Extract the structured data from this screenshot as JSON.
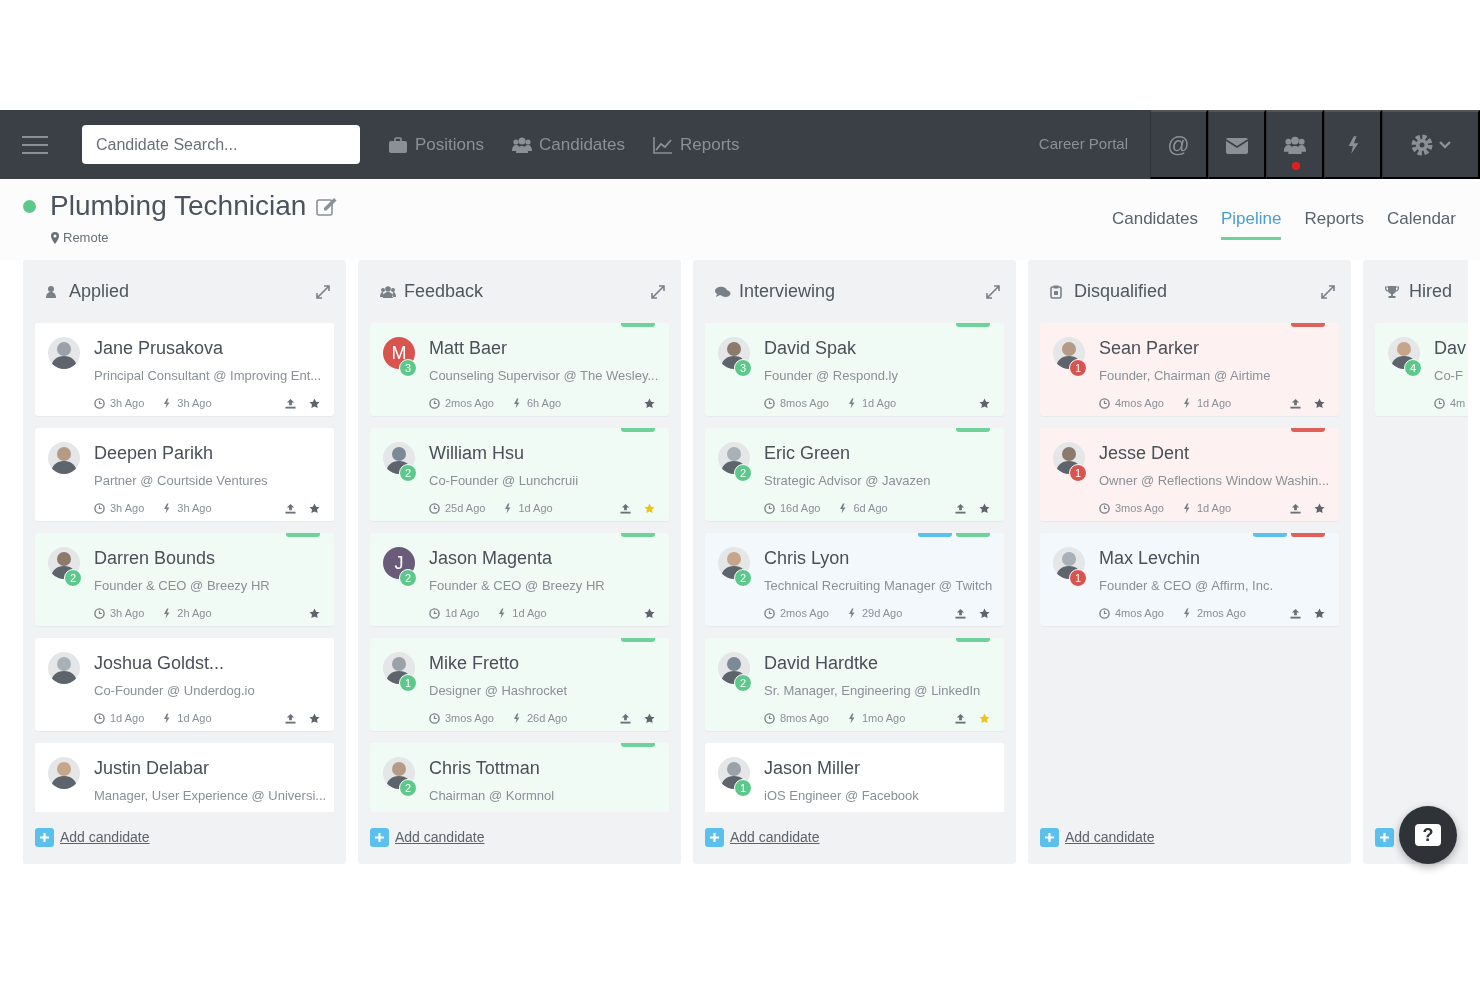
{
  "navbar": {
    "search": {
      "placeholder": "Candidate Search..."
    },
    "links": [
      {
        "label": "Positions"
      },
      {
        "label": "Candidates"
      },
      {
        "label": "Reports"
      }
    ],
    "career_portal": "Career Portal",
    "at_symbol": "@",
    "notification": true
  },
  "header": {
    "title": "Plumbing Technician",
    "location": "Remote",
    "tabs": [
      {
        "label": "Candidates",
        "selected": false
      },
      {
        "label": "Pipeline",
        "selected": true
      },
      {
        "label": "Reports",
        "selected": false
      },
      {
        "label": "Calendar",
        "selected": false
      }
    ]
  },
  "columns": [
    {
      "title": "Applied",
      "expandable": true,
      "add_label": "Add candidate",
      "cards": [
        {
          "name": "Jane Prusakova",
          "subtitle": "Principal Consultant @ Improving Ent...",
          "avatar": {
            "kind": "photo"
          },
          "ago": "3h Ago",
          "active": "3h Ago",
          "upload": true,
          "starred": false
        },
        {
          "name": "Deepen Parikh",
          "subtitle": "Partner @ Courtside Ventures",
          "avatar": {
            "kind": "photo"
          },
          "ago": "3h Ago",
          "active": "3h Ago",
          "upload": true,
          "starred": false
        },
        {
          "name": "Darren Bounds",
          "subtitle": "Founder & CEO @ Breezy HR",
          "avatar": {
            "kind": "photo"
          },
          "badge": {
            "text": "2",
            "color": "#5cc98a"
          },
          "tags": [
            {
              "color": "#6dd39a"
            }
          ],
          "color": "#f1fbf5",
          "ago": "3h Ago",
          "active": "2h Ago",
          "upload": false,
          "starred": false
        },
        {
          "name": "Joshua Goldst...",
          "subtitle": "Co-Founder @ Underdog.io",
          "avatar": {
            "kind": "photo"
          },
          "ago": "1d Ago",
          "active": "1d Ago",
          "upload": true,
          "starred": false
        },
        {
          "name": "Justin Delabar",
          "subtitle": "Manager, User Experience @ Universi...",
          "avatar": {
            "kind": "photo"
          }
        }
      ]
    },
    {
      "title": "Feedback",
      "expandable": true,
      "add_label": "Add candidate",
      "cards": [
        {
          "name": "Matt Baer",
          "subtitle": "Counseling Supervisor @ The Wesley...",
          "avatar": {
            "kind": "initial",
            "letter": "M",
            "color": "#d9534f"
          },
          "badge": {
            "text": "3",
            "color": "#5cc98a"
          },
          "tags": [
            {
              "color": "#6dd39a"
            }
          ],
          "color": "#f1fbf5",
          "ago": "2mos Ago",
          "active": "6h Ago",
          "upload": false,
          "starred": false
        },
        {
          "name": "William Hsu",
          "subtitle": "Co-Founder @ Lunchcruii",
          "avatar": {
            "kind": "photo"
          },
          "badge": {
            "text": "2",
            "color": "#5cc98a"
          },
          "tags": [
            {
              "color": "#6dd39a"
            }
          ],
          "color": "#f1fbf5",
          "ago": "25d Ago",
          "active": "1d Ago",
          "upload": true,
          "starred": true
        },
        {
          "name": "Jason Magenta",
          "subtitle": "Founder & CEO @ Breezy HR",
          "avatar": {
            "kind": "initial",
            "letter": "J",
            "color": "#6b5b7b"
          },
          "badge": {
            "text": "2",
            "color": "#5cc98a"
          },
          "tags": [
            {
              "color": "#6dd39a"
            }
          ],
          "color": "#f1fbf5",
          "ago": "1d Ago",
          "active": "1d Ago",
          "upload": false,
          "starred": false
        },
        {
          "name": "Mike Fretto",
          "subtitle": "Designer @ Hashrocket",
          "avatar": {
            "kind": "photo"
          },
          "badge": {
            "text": "1",
            "color": "#5cc98a"
          },
          "tags": [
            {
              "color": "#6dd39a"
            }
          ],
          "color": "#f1fbf5",
          "ago": "3mos Ago",
          "active": "26d Ago",
          "upload": true,
          "starred": false
        },
        {
          "name": "Chris Tottman",
          "subtitle": "Chairman @ Kormnol",
          "avatar": {
            "kind": "photo"
          },
          "badge": {
            "text": "2",
            "color": "#5cc98a"
          },
          "tags": [
            {
              "color": "#6dd39a"
            }
          ],
          "color": "#f1fbf5"
        }
      ]
    },
    {
      "title": "Interviewing",
      "expandable": true,
      "add_label": "Add candidate",
      "cards": [
        {
          "name": "David Spak",
          "subtitle": "Founder @ Respond.ly",
          "avatar": {
            "kind": "photo"
          },
          "badge": {
            "text": "3",
            "color": "#5cc98a"
          },
          "tags": [
            {
              "color": "#6dd39a"
            }
          ],
          "color": "#f1fbf5",
          "ago": "8mos Ago",
          "active": "1d Ago",
          "upload": false,
          "starred": false
        },
        {
          "name": "Eric Green",
          "subtitle": "Strategic Advisor @ Javazen",
          "avatar": {
            "kind": "photo"
          },
          "badge": {
            "text": "2",
            "color": "#5cc98a"
          },
          "tags": [
            {
              "color": "#6dd39a"
            }
          ],
          "color": "#f1fbf5",
          "ago": "16d Ago",
          "active": "6d Ago",
          "upload": true,
          "starred": false
        },
        {
          "name": "Chris Lyon",
          "subtitle": "Technical Recruiting Manager @ Twitch",
          "avatar": {
            "kind": "photo"
          },
          "badge": {
            "text": "2",
            "color": "#5cc98a"
          },
          "tags": [
            {
              "color": "#5bc0eb"
            },
            {
              "color": "#6dd39a"
            }
          ],
          "color": "#f2f8fc",
          "ago": "2mos Ago",
          "active": "29d Ago",
          "upload": true,
          "starred": false
        },
        {
          "name": "David Hardtke",
          "subtitle": "Sr. Manager, Engineering @ LinkedIn",
          "avatar": {
            "kind": "photo"
          },
          "badge": {
            "text": "2",
            "color": "#5cc98a"
          },
          "tags": [
            {
              "color": "#6dd39a"
            }
          ],
          "color": "#f1fbf5",
          "ago": "8mos Ago",
          "active": "1mo Ago",
          "upload": true,
          "starred": true
        },
        {
          "name": "Jason Miller",
          "subtitle": "iOS Engineer @ Facebook",
          "avatar": {
            "kind": "photo"
          },
          "badge": {
            "text": "1",
            "color": "#5cc98a"
          }
        }
      ]
    },
    {
      "title": "Disqualified",
      "expandable": true,
      "add_label": "Add candidate",
      "cards": [
        {
          "name": "Sean Parker",
          "subtitle": "Founder, Chairman @ Airtime",
          "avatar": {
            "kind": "photo"
          },
          "badge": {
            "text": "1",
            "color": "#d9534f"
          },
          "tags": [
            {
              "color": "#e0605a"
            }
          ],
          "color": "#fdf2f1",
          "ago": "4mos Ago",
          "active": "1d Ago",
          "upload": true,
          "starred": false
        },
        {
          "name": "Jesse Dent",
          "subtitle": "Owner @ Reflections Window Washin...",
          "avatar": {
            "kind": "photo"
          },
          "badge": {
            "text": "1",
            "color": "#d9534f"
          },
          "tags": [
            {
              "color": "#e0605a"
            }
          ],
          "color": "#fdf2f1",
          "ago": "3mos Ago",
          "active": "1d Ago",
          "upload": true,
          "starred": false
        },
        {
          "name": "Max Levchin",
          "subtitle": "Founder & CEO @ Affirm, Inc.",
          "avatar": {
            "kind": "photo"
          },
          "badge": {
            "text": "1",
            "color": "#d9534f"
          },
          "tags": [
            {
              "color": "#5bc0eb"
            },
            {
              "color": "#e0605a"
            }
          ],
          "color": "#f2f8fc",
          "ago": "4mos Ago",
          "active": "2mos Ago",
          "upload": true,
          "starred": false
        }
      ]
    },
    {
      "title": "Hired",
      "cards": [
        {
          "name": "Dav",
          "subtitle": "Co-F",
          "avatar": {
            "kind": "photo"
          },
          "badge": {
            "text": "4",
            "color": "#5cc98a"
          },
          "color": "#f1fbf5",
          "ago": "4m"
        }
      ]
    }
  ],
  "help_button": "?"
}
